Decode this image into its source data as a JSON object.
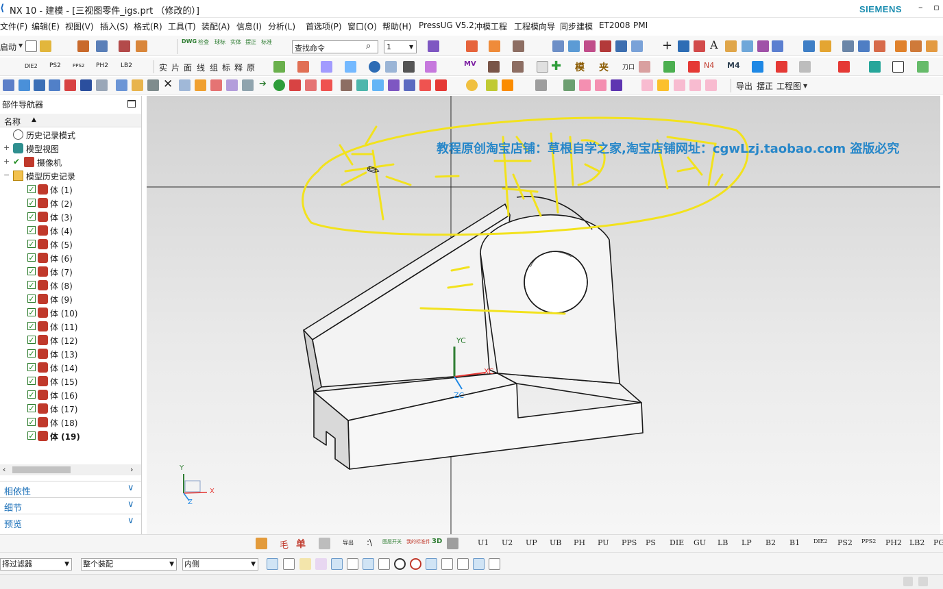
{
  "window": {
    "title": "NX 10 - 建模 - [三视图零件_igs.prt （修改的）]",
    "brand": "SIEMENS",
    "restore_glyph": "▫",
    "minimize_glyph": "–"
  },
  "menu": [
    "文件(F)",
    "编辑(E)",
    "视图(V)",
    "插入(S)",
    "格式(R)",
    "工具(T)",
    "装配(A)",
    "信息(I)",
    "分析(L)",
    "首选项(P)",
    "窗口(O)",
    "帮助(H)",
    "PressUG V5.2",
    "冲模工程",
    "工程模向导",
    "同步建模",
    "ET2008",
    "PMI"
  ],
  "toolbar1": {
    "start_label": "启动",
    "search_placeholder": "查找命令",
    "selection_value": "1",
    "dwg_labels": [
      "DWG",
      "检查",
      "球标",
      "实体",
      "摆正",
      "标准"
    ]
  },
  "toolbar2": {
    "labels": [
      "DIE2",
      "PS2",
      "PPS2",
      "PH2",
      "LB2"
    ],
    "chars": [
      "实",
      "片",
      "面",
      "线",
      "组",
      "标",
      "释",
      "原"
    ],
    "right_labels": [
      "MV",
      "模",
      "夹",
      "刀口",
      "N4",
      "M4"
    ]
  },
  "toolbar3": {
    "export": "导出",
    "orient": "摆正",
    "drawing": "工程图"
  },
  "navigator": {
    "title": "部件导航器",
    "column_name": "名称",
    "nodes": [
      "历史记录模式",
      "模型视图",
      "摄像机",
      "模型历史记录"
    ],
    "bodies": [
      "体 (1)",
      "体 (2)",
      "体 (3)",
      "体 (4)",
      "体 (5)",
      "体 (6)",
      "体 (7)",
      "体 (8)",
      "体 (9)",
      "体 (10)",
      "体 (11)",
      "体 (12)",
      "体 (13)",
      "体 (14)",
      "体 (15)",
      "体 (16)",
      "体 (17)",
      "体 (18)",
      "体 (19)"
    ],
    "sections": [
      "相依性",
      "细节",
      "预览"
    ]
  },
  "graphics": {
    "watermark": "教程原创淘宝店铺：草根自学之家,淘宝店铺网址：cgwLzj.taobao.com  盗版必究",
    "wcs": {
      "y": "YC",
      "x": "XC",
      "z": "ZC"
    },
    "triad": {
      "y": "Y",
      "x": "X",
      "z": "Z"
    },
    "colors": {
      "annotation": "#f2e21d",
      "watermark": "#2787c9",
      "part_face": "#f4f4f4"
    }
  },
  "bottom_toolbar": [
    "单",
    "导出",
    "图层开关",
    "我的标准件",
    "3D",
    "U1",
    "U2",
    "UP",
    "UB",
    "PH",
    "PU",
    "PPS",
    "PS",
    "DIE",
    "GU",
    "LB",
    "LP",
    "B2",
    "B1",
    "DIE2",
    "PS2",
    "PPS2",
    "PH2",
    "LB2",
    "PG"
  ],
  "filters": {
    "type_filter": "择过滤器",
    "scope": "整个装配",
    "inside": "内侧"
  }
}
